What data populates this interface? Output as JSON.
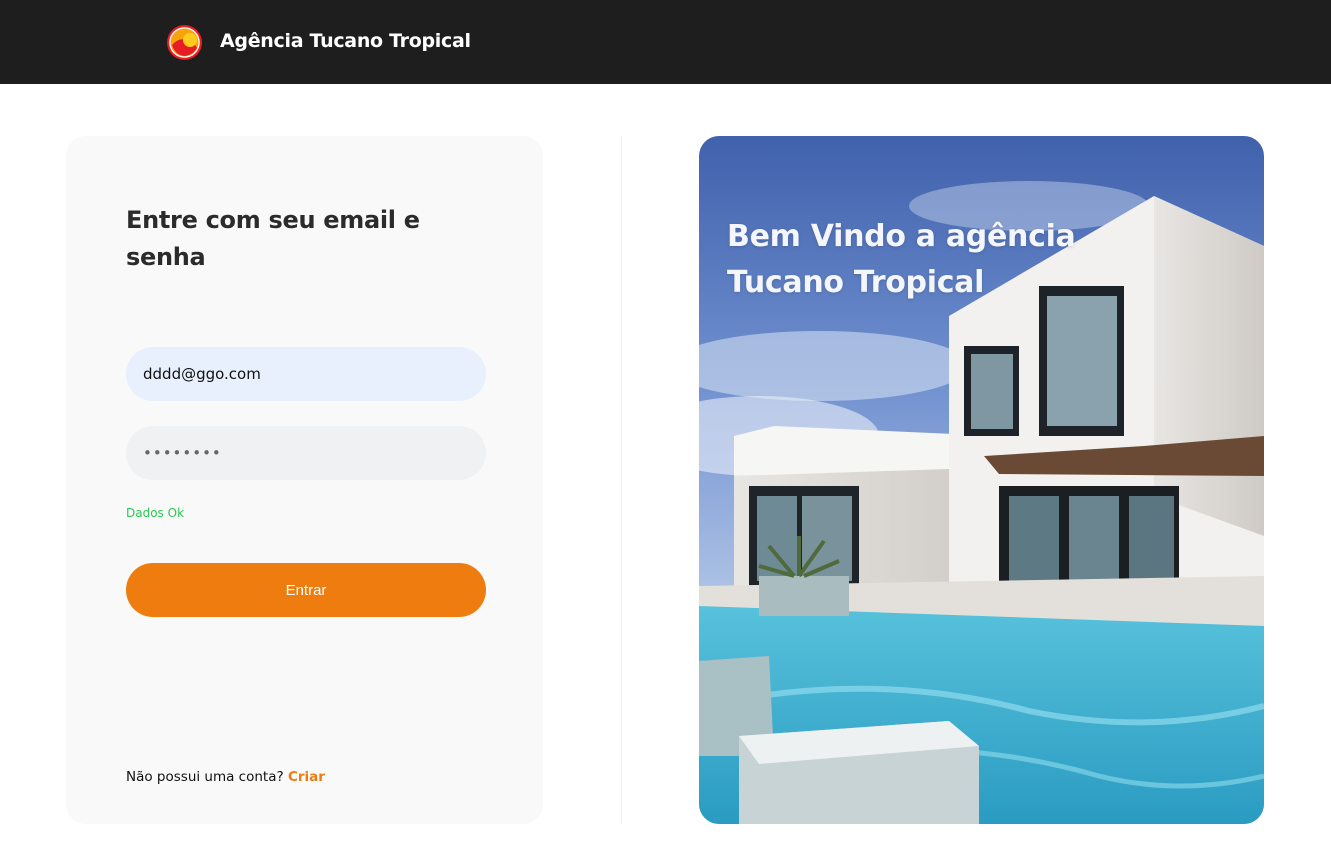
{
  "header": {
    "brand": "Agência Tucano Tropical",
    "logo_icon": "sunset-circle-logo-icon"
  },
  "login": {
    "title": "Entre com seu email e senha",
    "email_value": "dddd@ggo.com",
    "email_placeholder": "",
    "password_value": "dddddddd",
    "status": "Dados Ok",
    "submit_label": "Entrar",
    "signup_prompt": "Não possui uma conta?",
    "signup_link": "Criar"
  },
  "hero": {
    "welcome": "Bem Vindo a agência Tucano Tropical",
    "image_icon": "modern-house-pool-image"
  },
  "colors": {
    "accent": "#ee7c0e",
    "header_bg": "#1e1e1e",
    "status_ok": "#2dc653",
    "email_bg": "#e8f0fe"
  }
}
